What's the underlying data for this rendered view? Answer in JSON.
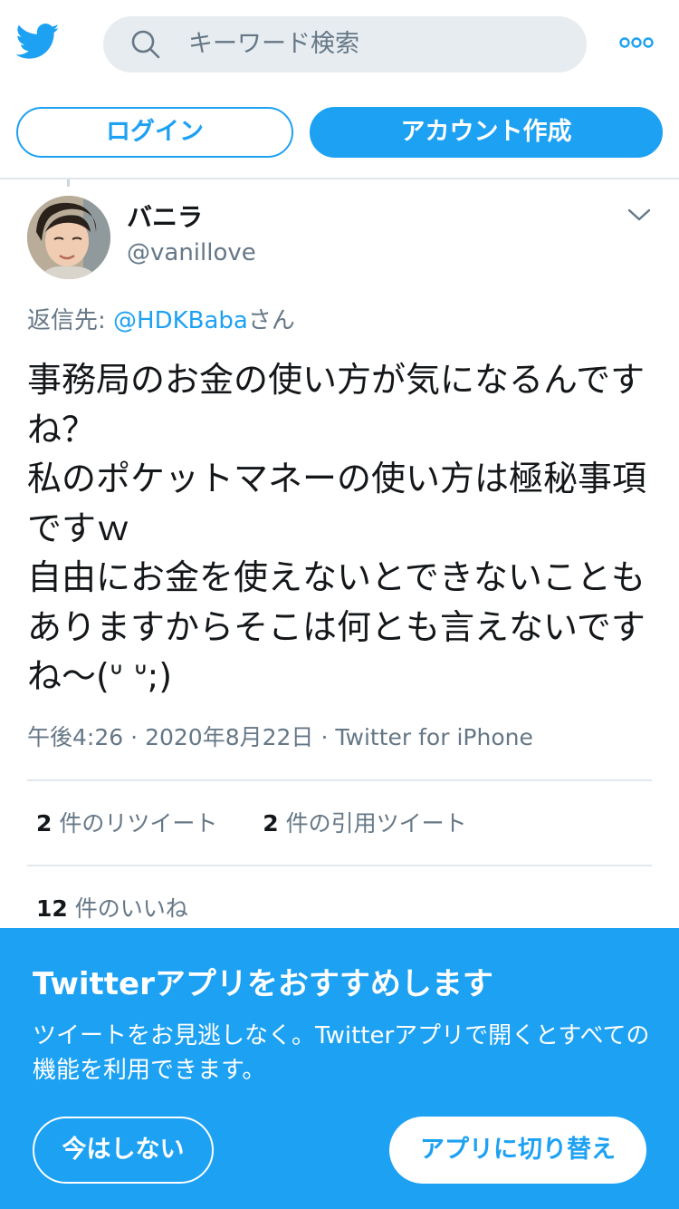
{
  "header": {
    "search_placeholder": "キーワード検索",
    "login_label": "ログイン",
    "signup_label": "アカウント作成"
  },
  "tweet": {
    "display_name": "バニラ",
    "handle": "@vanillove",
    "reply_prefix": "返信先: ",
    "reply_mention": "@HDKBaba",
    "reply_suffix": "さん",
    "text": "事務局のお金の使い方が気になるんですね？\n私のポケットマネーの使い方は極秘事項ですｗ\n自由にお金を使えないとできないこともありますからそこは何とも言えないですね〜(ᐡ ᐡ;)",
    "time": "午後4:26",
    "date": "2020年8月22日",
    "source": "Twitter for iPhone",
    "retweet_count": "2",
    "retweet_label": " 件のリツイート",
    "quote_count": "2",
    "quote_label": " 件の引用ツイート",
    "like_count": "12",
    "like_label": " 件のいいね"
  },
  "banner": {
    "title": "Twitterアプリをおすすめします",
    "description": "ツイートをお見逃しなく。Twitterアプリで開くとすべての機能を利用できます。",
    "dismiss_label": "今はしない",
    "switch_label": "アプリに切り替え"
  },
  "colors": {
    "accent": "#1da1f2",
    "secondary_text": "#657786",
    "divider": "#e1e8ed"
  },
  "icons": [
    "twitter-bird-icon",
    "search-icon",
    "more-icon",
    "chevron-down-icon"
  ]
}
